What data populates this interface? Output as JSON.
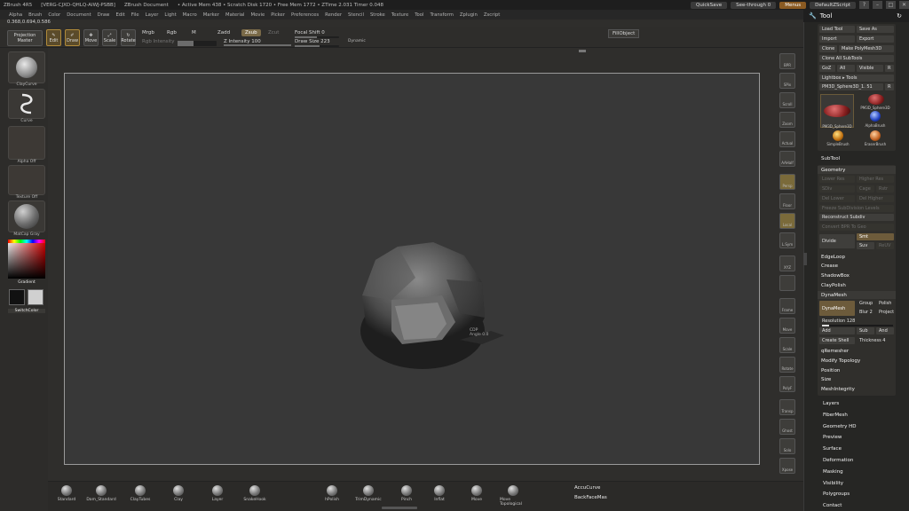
{
  "titlebar": {
    "app": "ZBrush 4R5",
    "build": "[VERG-CJXD-QHLQ-AIWJ-PSBB]",
    "document": "ZBrush Document",
    "mem": "• Active Mem 438 • Scratch Disk 1720 • Free Mem 1772 • ZTime 2.031 Timer 0.048",
    "quicksave": "QuickSave",
    "seethrough": "See-through   0",
    "menus_btn": "Menus",
    "script": "DefaultZScript"
  },
  "menubar": [
    "Alpha",
    "Brush",
    "Color",
    "Document",
    "Draw",
    "Edit",
    "File",
    "Layer",
    "Light",
    "Macro",
    "Marker",
    "Material",
    "Movie",
    "Picker",
    "Preferences",
    "Render",
    "Stencil",
    "Stroke",
    "Texture",
    "Tool",
    "Transform",
    "Zplugin",
    "Zscript"
  ],
  "coords": "0.368,0.694,0.586",
  "shelf": {
    "projection": "Projection",
    "master": "Master",
    "edit": "Edit",
    "draw": "Draw",
    "move": "Move",
    "scale": "Scale",
    "rotate": "Rotate",
    "mrgb": "Mrgb",
    "rgb": "Rgb",
    "m": "M",
    "rgb_intensity": "Rgb Intensity",
    "zadd": "Zadd",
    "zsub": "Zsub",
    "zcut": "Zcut",
    "z_intensity": "Z Intensity 100",
    "focal_shift": "Focal Shift 0",
    "draw_size": "Draw Size 223",
    "dynamic": "Dynamic",
    "fill_object": "FillObject"
  },
  "lefttray": {
    "brush": "ClayCurve",
    "stroke": "Curve",
    "alpha": "Alpha Off",
    "texture": "Texture Off",
    "material": "MatCap Gray",
    "gradient": "Gradient",
    "switch_color": "SwitchColor"
  },
  "viewport": {
    "tooltip_title": "CDP",
    "tooltip_sub": "Angle 0.0"
  },
  "rightcol": [
    "BPR",
    "SPix",
    "Scroll",
    "Zoom",
    "Actual",
    "AAHalf",
    "Persp",
    "Floor",
    "Local",
    "L.Sym",
    "XYZ",
    "",
    "Frame",
    "Move",
    "Scale",
    "Rotate",
    "PolyF",
    "Transp",
    "Ghost",
    "Solo",
    "Xpose"
  ],
  "palette": {
    "title": "Tool",
    "load_tool": "Load Tool",
    "save_as": "Save As",
    "import": "Import",
    "export": "Export",
    "clone": "Clone",
    "make_polymesh": "Make PolyMesh3D",
    "clone_all": "Clone All SubTools",
    "goz": "GoZ",
    "all": "All",
    "visible": "Visible",
    "r": "R",
    "lightbox": "Lightbox ▸ Tools",
    "current_tool": "PM3D_Sphere3D_1. 51",
    "thumbs": [
      "PM3D_Sphere3D",
      "PM3D_Sphere3D",
      "AlphaBrush",
      "SimpleBrush",
      "EraserBrush"
    ],
    "subtool": "SubTool",
    "geometry": "Geometry",
    "lower_res": "Lower Res",
    "higher_res": "Higher Res",
    "sdiv": "SDiv",
    "cage": "Cage",
    "rstr": "Rstr",
    "del_lower": "Del Lower",
    "del_higher": "Del Higher",
    "freeze_subdiv": "Freeze SubDivision Levels",
    "reconstruct": "Reconstruct Subdiv",
    "convert_bpr": "Convert BPR To Geo",
    "divide": "Divide",
    "smt": "Smt",
    "suv": "Suv",
    "reuv": "ReUV",
    "edgeloop": "EdgeLoop",
    "crease": "Crease",
    "shadowbox": "ShadowBox",
    "claypolish": "ClayPolish",
    "dynamesh": "DynaMesh",
    "dynamesh_btn": "DynaMesh",
    "group": "Group",
    "polish": "Polish",
    "blur": "Blur 2",
    "project": "Project",
    "resolution": "Resolution 128",
    "add": "Add",
    "sub": "Sub",
    "and": "And",
    "create_shell": "Create Shell",
    "thickness": "Thickness 4",
    "qremesher": "qRemesher",
    "modify_topology": "Modify Topology",
    "position": "Position",
    "size": "Size",
    "meshintegrity": "MeshIntegrity",
    "sections": [
      "Layers",
      "FiberMesh",
      "Geometry HD",
      "Preview",
      "Surface",
      "Deformation",
      "Masking",
      "Visibility",
      "Polygroups",
      "Contact"
    ]
  },
  "bottom": {
    "brushes": [
      "Standard",
      "Dam_Standard",
      "ClayTubes",
      "Clay",
      "Layer",
      "SnakeHook",
      "hPolish",
      "TrimDynamic",
      "Pinch",
      "Inflat",
      "Move",
      "Move Topological"
    ],
    "accucurve": "AccuCurve",
    "backfacemask": "BackFaceMas"
  },
  "colors": {
    "accent": "#b08a3a",
    "bg": "#2f2e2c",
    "canvas": "#383838"
  }
}
